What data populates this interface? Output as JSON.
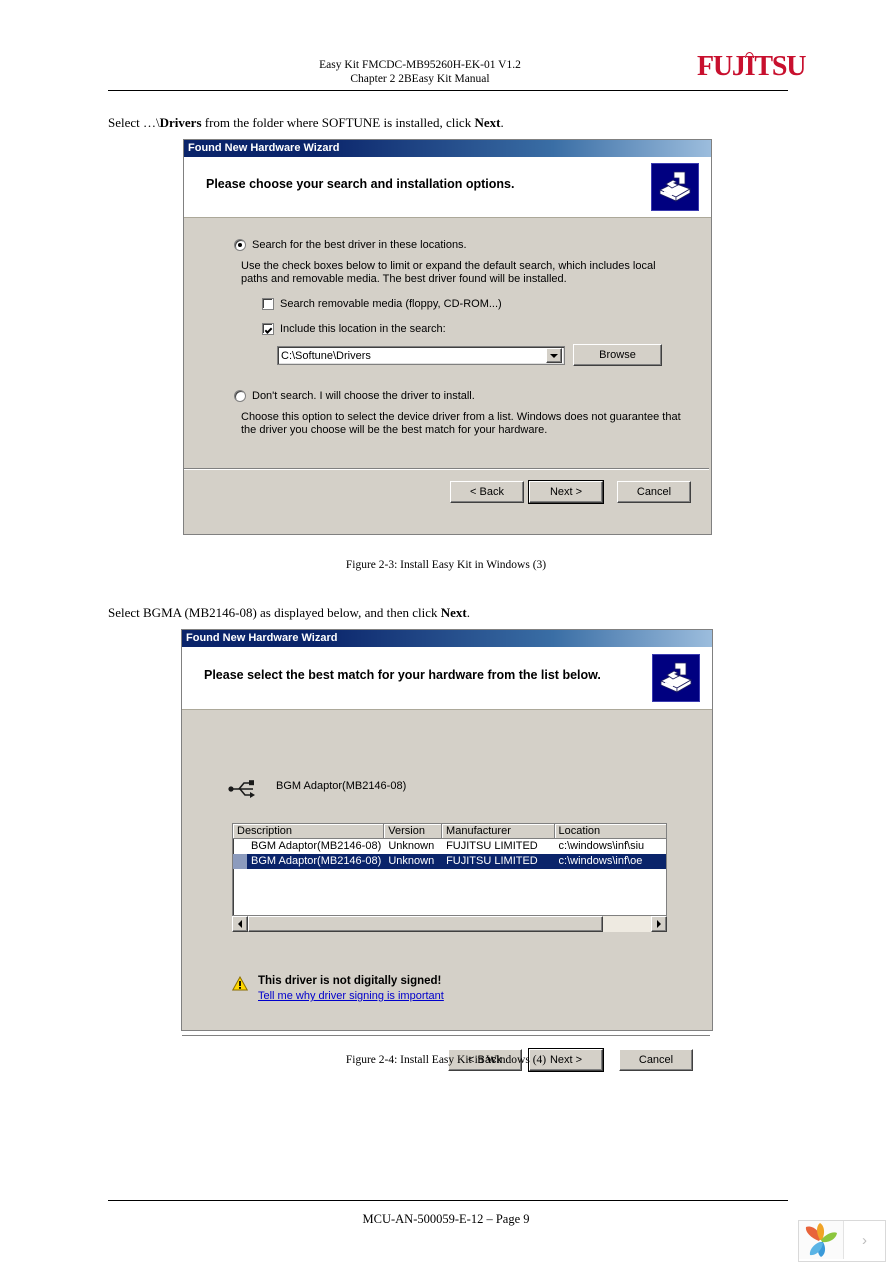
{
  "header": {
    "line1": "Easy Kit FMCDC-MB95260H-EK-01 V1.2",
    "line2": "Chapter 2 2BEasy Kit Manual",
    "brand": "FUJITSU"
  },
  "intro1": {
    "before": "Select …\\",
    "bold": "Drivers",
    "after": " from the folder where SOFTUNE is installed, click ",
    "bold2": "Next",
    "end": "."
  },
  "intro2": {
    "before": "Select BGMA (MB2146-08) as displayed below, and then click ",
    "bold": "Next",
    "end": "."
  },
  "dialog1": {
    "title": "Found New Hardware Wizard",
    "heading": "Please choose your search and installation options.",
    "icon": "wizard-device-icon",
    "radio_search_label": "Search for the best driver in these locations.",
    "radio_search_selected": true,
    "search_description": "Use the check boxes below to limit or expand the default search, which includes local paths and removable media. The best driver found will be installed.",
    "check_removable_label": "Search removable media (floppy, CD-ROM...)",
    "check_removable_checked": false,
    "check_include_label": "Include this location in the search:",
    "check_include_checked": true,
    "path_value": "C:\\Softune\\Drivers",
    "browse_label": "Browse",
    "radio_dontsearch_label": "Don't search. I will choose the driver to install.",
    "radio_dontsearch_selected": false,
    "dontsearch_description": "Choose this option to select the device driver from a list.  Windows does not guarantee that the driver you choose will be the best match for your hardware.",
    "back_label": "< Back",
    "next_label": "Next >",
    "cancel_label": "Cancel"
  },
  "figure1_caption": "Figure 2-3: Install Easy Kit in Windows (3)",
  "dialog2": {
    "title": "Found New Hardware Wizard",
    "heading": "Please select the best match for your hardware from the list below.",
    "icon": "wizard-device-icon",
    "device_icon": "usb-icon",
    "device_label": "BGM Adaptor(MB2146-08)",
    "columns": [
      "Description",
      "Version",
      "Manufacturer",
      "Location"
    ],
    "rows": [
      {
        "description": "BGM Adaptor(MB2146-08)",
        "version": "Unknown",
        "manufacturer": "FUJITSU LIMITED",
        "location": "c:\\windows\\inf\\siu",
        "selected": false
      },
      {
        "description": "BGM Adaptor(MB2146-08)",
        "version": "Unknown",
        "manufacturer": "FUJITSU LIMITED",
        "location": "c:\\windows\\inf\\oe",
        "selected": true
      }
    ],
    "warning_title": "This driver is not digitally signed!",
    "warning_link": "Tell me why driver signing is important",
    "warning_icon": "warning-triangle-icon",
    "back_label": "< Back",
    "next_label": "Next >",
    "cancel_label": "Cancel"
  },
  "figure2_caption": "Figure 2-4: Install Easy Kit in Windows (4)",
  "footer": {
    "text": "MCU-AN-500059-E-12 – Page 9"
  },
  "corner": {
    "logo_icon": "leaf-logo-icon",
    "chevron": "›"
  }
}
